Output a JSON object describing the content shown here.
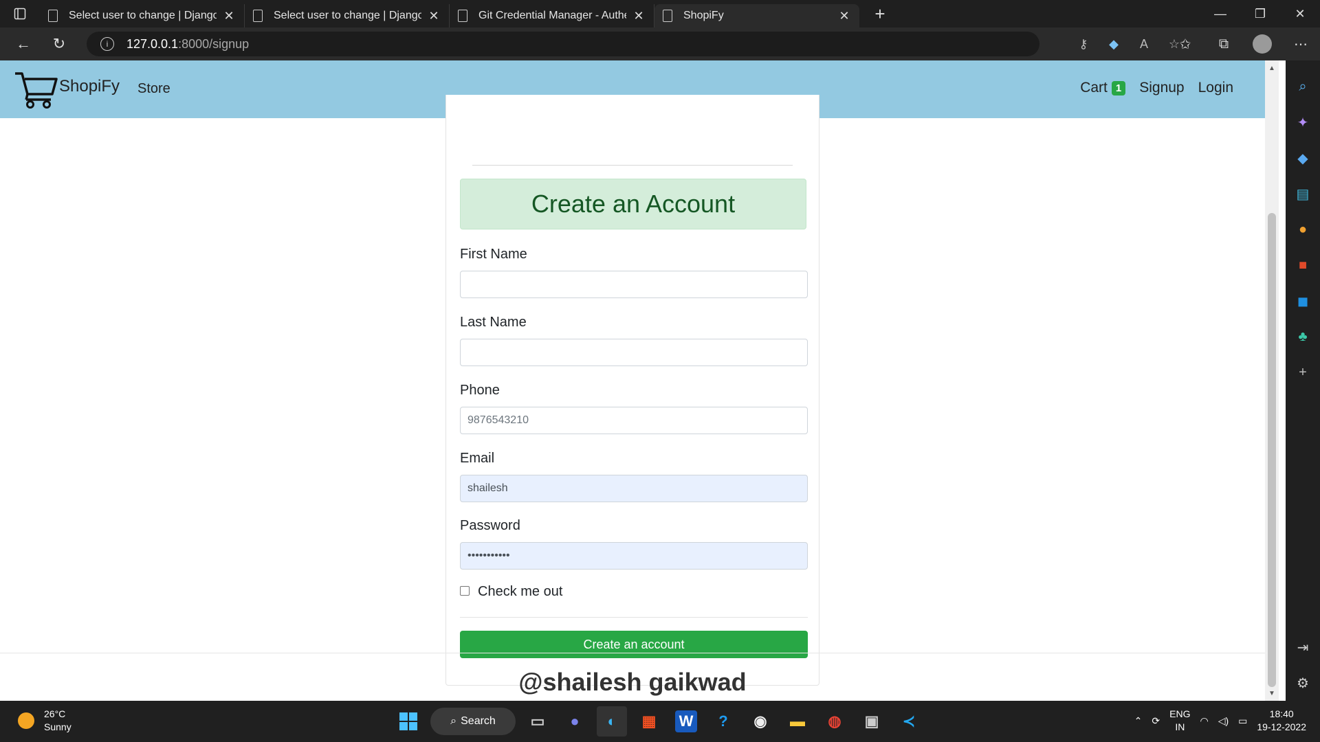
{
  "browser": {
    "tabs": [
      {
        "title": "Select user to change | Django si",
        "active": false
      },
      {
        "title": "Select user to change | Django si",
        "active": false
      },
      {
        "title": "Git Credential Manager - Authen",
        "active": false
      },
      {
        "title": "ShopiFy",
        "active": true
      }
    ],
    "url_host": "127.0.0.1",
    "url_path": ":8000/signup"
  },
  "site": {
    "brand": "ShopiFy",
    "store_link": "Store",
    "cart_label": "Cart",
    "cart_count": "1",
    "signup_link": "Signup",
    "login_link": "Login"
  },
  "form": {
    "header": "Create an Account",
    "first_name_label": "First Name",
    "first_name_value": "",
    "last_name_label": "Last Name",
    "last_name_value": "",
    "phone_label": "Phone",
    "phone_placeholder": "9876543210",
    "email_label": "Email",
    "email_value": "shailesh",
    "password_label": "Password",
    "password_value": "•••••••••••",
    "checkbox_label": "Check me out",
    "submit_label": "Create an account"
  },
  "footer": {
    "text": "@shailesh gaikwad"
  },
  "taskbar": {
    "temperature": "26°C",
    "weather": "Sunny",
    "search_label": "Search",
    "lang_top": "ENG",
    "lang_bottom": "IN",
    "time": "18:40",
    "date": "19-12-2022"
  },
  "colors": {
    "navbar": "#93c9e1",
    "success": "#28a745",
    "header_bg": "#d4edda",
    "header_text": "#155724"
  }
}
